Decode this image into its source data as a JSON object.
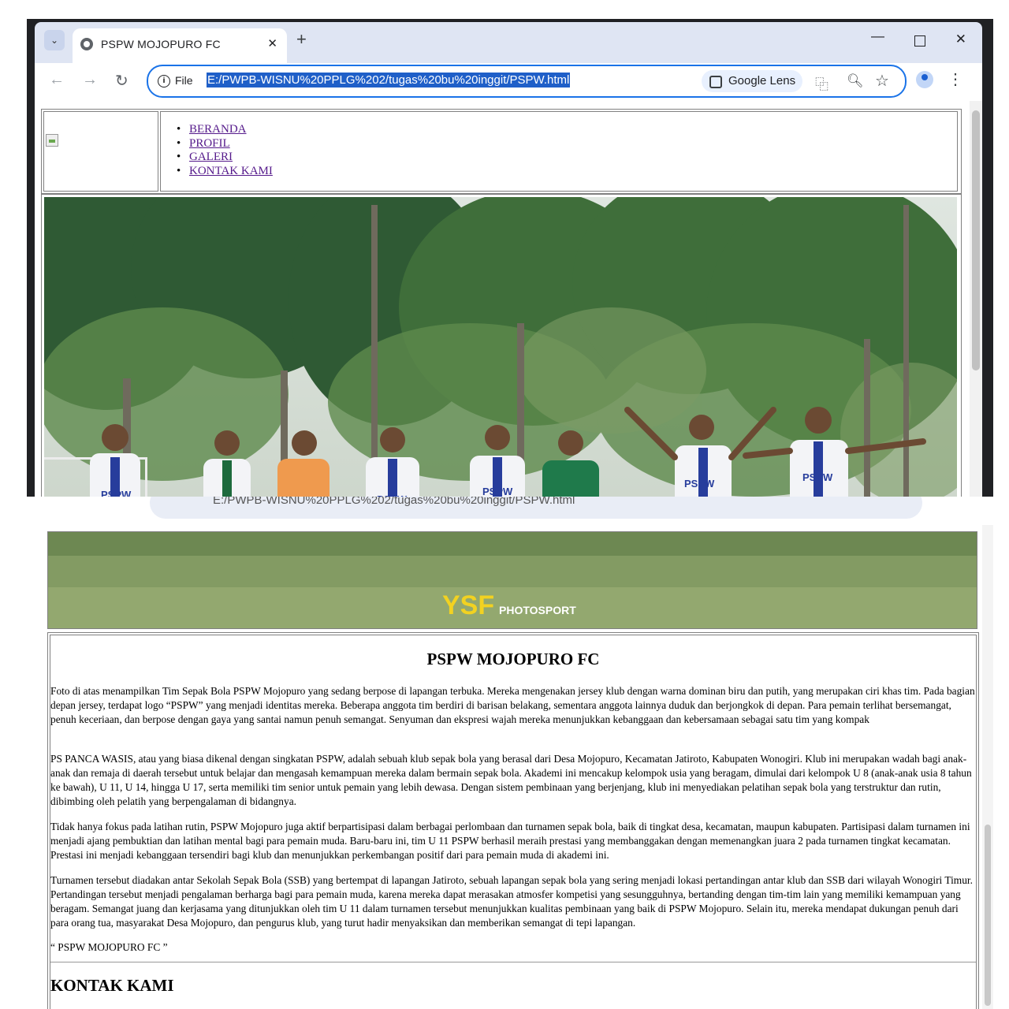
{
  "browser": {
    "tab_title": "PSPW MOJOPURO FC",
    "tab_close": "✕",
    "new_tab": "+",
    "file_label": "File",
    "url": "E:/PWPB-WISNU%20PPLG%202/tugas%20bu%20inggit/PSPW.html",
    "lens_label": "Google Lens",
    "icons": [
      "chevron-down-icon",
      "globe-icon",
      "close-icon",
      "plus-icon",
      "minimize-icon",
      "maximize-icon",
      "close-window-icon",
      "back-arrow-icon",
      "forward-arrow-icon",
      "reload-icon",
      "info-icon",
      "lens-icon",
      "translate-icon",
      "zoom-icon",
      "star-icon",
      "profile-icon",
      "kebab-menu-icon"
    ]
  },
  "nav": {
    "items": [
      "BERANDA",
      "PROFIL",
      "GALERI",
      "KONTAK KAMI"
    ]
  },
  "photo": {
    "watermark_main": "YSF",
    "watermark_sub": "PHOTOSPORT",
    "jersey_text": "PSPW"
  },
  "article": {
    "title": "PSPW MOJOPURO FC",
    "paragraphs": [
      "Foto di atas menampilkan Tim Sepak Bola PSPW Mojopuro yang sedang berpose di lapangan terbuka. Mereka mengenakan jersey klub dengan warna dominan biru dan putih, yang merupakan ciri khas tim. Pada bagian depan jersey, terdapat logo “PSPW” yang menjadi identitas mereka. Beberapa anggota tim berdiri di barisan belakang, sementara anggota lainnya duduk dan berjongkok di depan. Para pemain terlihat bersemangat, penuh keceriaan, dan berpose dengan gaya yang santai namun penuh semangat. Senyuman dan ekspresi wajah mereka menunjukkan kebanggaan dan kebersamaan sebagai satu tim yang kompak",
      "PS PANCA WASIS, atau yang biasa dikenal dengan singkatan PSPW, adalah sebuah klub sepak bola yang berasal dari Desa Mojopuro, Kecamatan Jatiroto, Kabupaten Wonogiri. Klub ini merupakan wadah bagi anak-anak dan remaja di daerah tersebut untuk belajar dan mengasah kemampuan mereka dalam bermain sepak bola. Akademi ini mencakup kelompok usia yang beragam, dimulai dari kelompok U 8 (anak-anak usia 8 tahun ke bawah), U 11, U 14, hingga U 17, serta memiliki tim senior untuk pemain yang lebih dewasa. Dengan sistem pembinaan yang berjenjang, klub ini menyediakan pelatihan sepak bola yang terstruktur dan rutin, dibimbing oleh pelatih yang berpengalaman di bidangnya.",
      "Tidak hanya fokus pada latihan rutin, PSPW Mojopuro juga aktif berpartisipasi dalam berbagai perlombaan dan turnamen sepak bola, baik di tingkat desa, kecamatan, maupun kabupaten. Partisipasi dalam turnamen ini menjadi ajang pembuktian dan latihan mental bagi para pemain muda. Baru-baru ini, tim U 11 PSPW berhasil meraih prestasi yang membanggakan dengan memenangkan juara 2 pada turnamen tingkat kecamatan. Prestasi ini menjadi kebanggaan tersendiri bagi klub dan menunjukkan perkembangan positif dari para pemain muda di akademi ini.",
      "Turnamen tersebut diadakan antar Sekolah Sepak Bola (SSB) yang bertempat di lapangan Jatiroto, sebuah lapangan sepak bola yang sering menjadi lokasi pertandingan antar klub dan SSB dari wilayah Wonogiri Timur. Pertandingan tersebut menjadi pengalaman berharga bagi para pemain muda, karena mereka dapat merasakan atmosfer kompetisi yang sesungguhnya, bertanding dengan tim-tim lain yang memiliki kemampuan yang beragam. Semangat juang dan kerjasama yang ditunjukkan oleh tim U 11 dalam turnamen tersebut menunjukkan kualitas pembinaan yang baik di PSPW Mojopuro. Selain itu, mereka mendapat dukungan penuh dari para orang tua, masyarakat Desa Mojopuro, dan pengurus klub, yang turut hadir menyaksikan dan memberikan semangat di tepi lapangan."
    ],
    "quote": "“ PSPW MOJOPURO FC ”",
    "contact_heading": "KONTAK KAMI"
  }
}
